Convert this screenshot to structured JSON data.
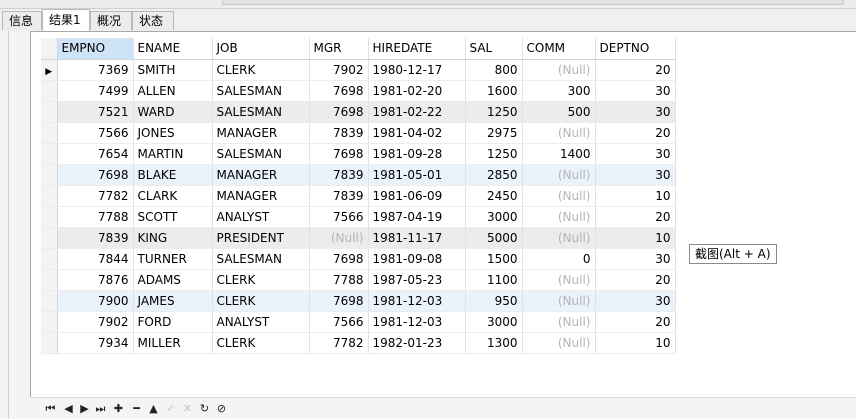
{
  "tabs": [
    {
      "label": "信息"
    },
    {
      "label": "结果1"
    },
    {
      "label": "概况"
    },
    {
      "label": "状态"
    }
  ],
  "columns": [
    "EMPNO",
    "ENAME",
    "JOB",
    "MGR",
    "HIREDATE",
    "SAL",
    "COMM",
    "DEPTNO"
  ],
  "rows": [
    [
      "7369",
      "SMITH",
      "CLERK",
      "7902",
      "1980-12-17",
      "800",
      "(Null)",
      "20"
    ],
    [
      "7499",
      "ALLEN",
      "SALESMAN",
      "7698",
      "1981-02-20",
      "1600",
      "300",
      "30"
    ],
    [
      "7521",
      "WARD",
      "SALESMAN",
      "7698",
      "1981-02-22",
      "1250",
      "500",
      "30"
    ],
    [
      "7566",
      "JONES",
      "MANAGER",
      "7839",
      "1981-04-02",
      "2975",
      "(Null)",
      "20"
    ],
    [
      "7654",
      "MARTIN",
      "SALESMAN",
      "7698",
      "1981-09-28",
      "1250",
      "1400",
      "30"
    ],
    [
      "7698",
      "BLAKE",
      "MANAGER",
      "7839",
      "1981-05-01",
      "2850",
      "(Null)",
      "30"
    ],
    [
      "7782",
      "CLARK",
      "MANAGER",
      "7839",
      "1981-06-09",
      "2450",
      "(Null)",
      "10"
    ],
    [
      "7788",
      "SCOTT",
      "ANALYST",
      "7566",
      "1987-04-19",
      "3000",
      "(Null)",
      "20"
    ],
    [
      "7839",
      "KING",
      "PRESIDENT",
      "(Null)",
      "1981-11-17",
      "5000",
      "(Null)",
      "10"
    ],
    [
      "7844",
      "TURNER",
      "SALESMAN",
      "7698",
      "1981-09-08",
      "1500",
      "0",
      "30"
    ],
    [
      "7876",
      "ADAMS",
      "CLERK",
      "7788",
      "1987-05-23",
      "1100",
      "(Null)",
      "20"
    ],
    [
      "7900",
      "JAMES",
      "CLERK",
      "7698",
      "1981-12-03",
      "950",
      "(Null)",
      "30"
    ],
    [
      "7902",
      "FORD",
      "ANALYST",
      "7566",
      "1981-12-03",
      "3000",
      "(Null)",
      "20"
    ],
    [
      "7934",
      "MILLER",
      "CLERK",
      "7782",
      "1982-01-23",
      "1300",
      "(Null)",
      "10"
    ]
  ],
  "tooltip": "截图(Alt + A)",
  "nav": {
    "first": "⏮",
    "prev": "◀",
    "next": "▶",
    "last": "⏭",
    "add": "✚",
    "delete": "━",
    "up": "▲",
    "apply": "✓",
    "cancel": "✕",
    "refresh": "↻",
    "stop": "⊘"
  },
  "colors": {
    "selected_header": "#cfe3f6",
    "alt_row": "#ececec",
    "highlight_row": "#eaf2fb",
    "null_text": "#b5b5b5"
  }
}
